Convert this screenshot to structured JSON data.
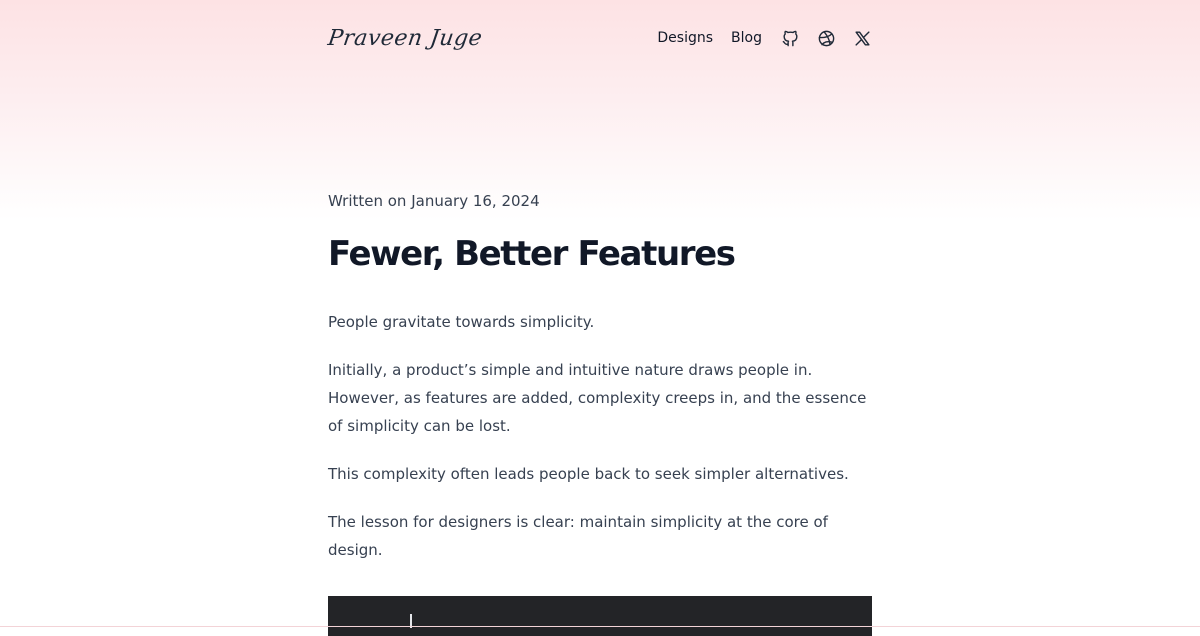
{
  "header": {
    "logo_text": "Praveen Juge",
    "nav": [
      {
        "label": "Designs"
      },
      {
        "label": "Blog"
      }
    ],
    "icons": [
      "github-icon",
      "dribbble-icon",
      "x-icon"
    ]
  },
  "post": {
    "written_on": "Written on January 16, 2024",
    "title": "Fewer, Better Features",
    "paragraphs": [
      "People gravitate towards simplicity.",
      "Initially, a product’s simple and intuitive nature draws people in. However, as features are added, complexity creeps in, and the essence of simplicity can be lost.",
      "This complexity often leads people back to seek simpler alternatives.",
      "The lesson for designers is clear: maintain simplicity at the core of design."
    ]
  },
  "colors": {
    "accent_gradient_top": "#fde2e4",
    "text_dark": "#111827",
    "text_body": "#374151",
    "image_bg": "#232427"
  }
}
